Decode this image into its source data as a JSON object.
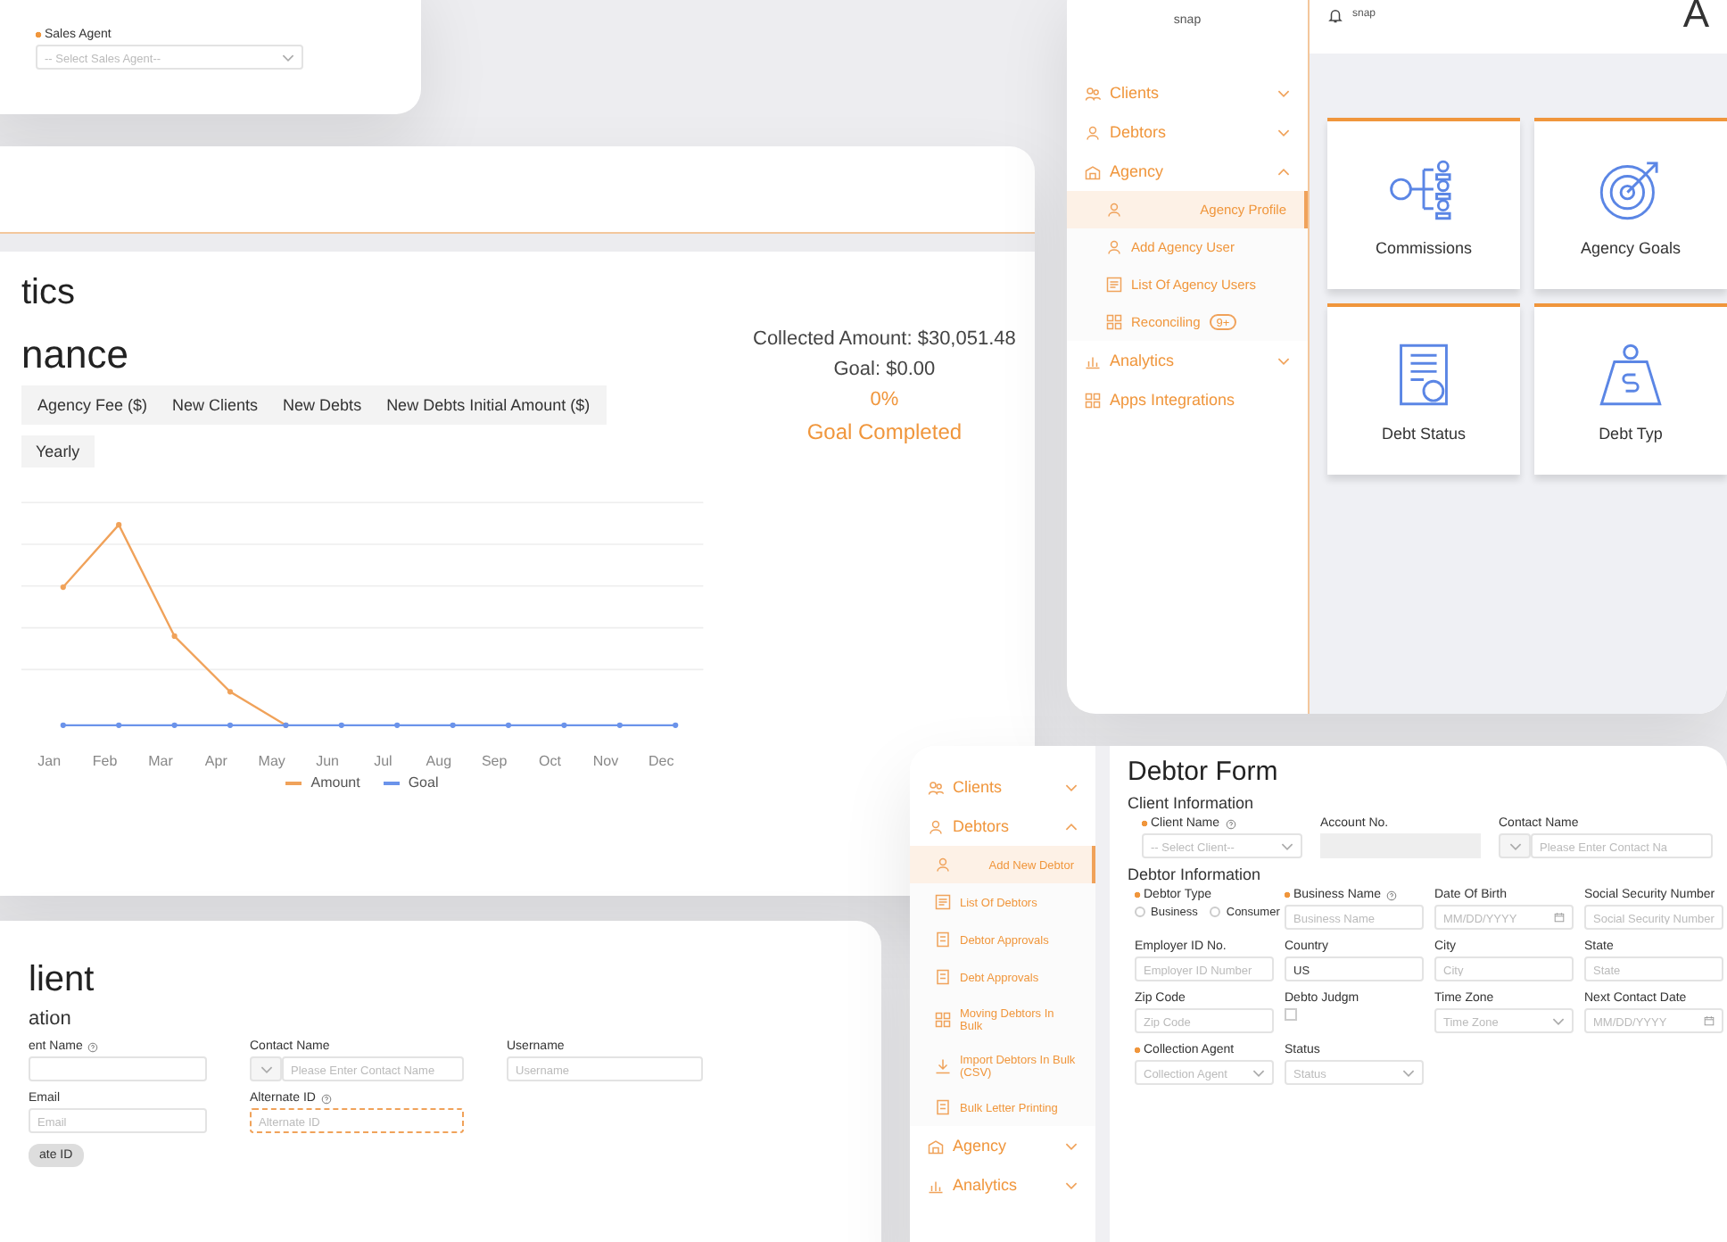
{
  "sales_agent_panel": {
    "field": {
      "label": "Sales Agent",
      "kind": "select",
      "required": true,
      "help": false,
      "placeholder": "-- Select Sales Agent--"
    }
  },
  "analytics_panel": {
    "title": "tics",
    "section_title": "nance",
    "tabs": [
      {
        "label": "Agency Fee ($)",
        "selected": false
      },
      {
        "label": "New Clients",
        "selected": false
      },
      {
        "label": "New Debts",
        "selected": false
      },
      {
        "label": "New Debts Initial Amount ($)",
        "selected": false
      }
    ],
    "period_button": "Yearly",
    "chart": {
      "months": [
        "Jan",
        "Feb",
        "Mar",
        "Apr",
        "May",
        "Jun",
        "Jul",
        "Aug",
        "Sep",
        "Oct",
        "Nov",
        "Dec"
      ],
      "legend": [
        {
          "label": "Amount",
          "color": "#f0a25a"
        },
        {
          "label": "Goal",
          "color": "#6b93ea"
        }
      ]
    },
    "stats": {
      "collected": "Collected Amount: $30,051.48",
      "goal": "Goal: $0.00",
      "percent": "0%",
      "status": "Goal Completed"
    }
  },
  "agency_app": {
    "logo": "snap",
    "user": "snap",
    "page_letter": "A",
    "sidebar": [
      {
        "label": "Clients",
        "kind": "group",
        "expanded": false
      },
      {
        "label": "Debtors",
        "kind": "group",
        "expanded": false
      },
      {
        "label": "Agency",
        "kind": "group",
        "expanded": true,
        "children": [
          {
            "label": "Agency Profile",
            "selected": true
          },
          {
            "label": "Add Agency User",
            "selected": false
          },
          {
            "label": "List Of Agency Users",
            "selected": false
          },
          {
            "label": "Reconciling",
            "selected": false,
            "badge": "9+"
          }
        ]
      },
      {
        "label": "Analytics",
        "kind": "group",
        "expanded": false
      },
      {
        "label": "Apps Integrations",
        "kind": "link"
      }
    ],
    "cards": [
      {
        "label": "Commissions"
      },
      {
        "label": "Agency Goals"
      },
      {
        "label": "Debt Status"
      },
      {
        "label": "Debt Typ"
      }
    ]
  },
  "client_form": {
    "title": "lient",
    "section": "ation",
    "fields": [
      {
        "label": "ent Name",
        "kind": "input",
        "required": false,
        "help": true,
        "focused": false
      },
      {
        "label": "Contact Name",
        "kind": "phone",
        "required": false,
        "help": false,
        "focused": false,
        "placeholder": "Please Enter Contact Name"
      },
      {
        "label": "Username",
        "kind": "input",
        "required": false,
        "help": false,
        "focused": false,
        "placeholder": "Username"
      },
      {
        "label": "Email",
        "kind": "input",
        "required": false,
        "help": false,
        "focused": false,
        "placeholder": "Email"
      },
      {
        "label": "Alternate ID",
        "kind": "input",
        "required": false,
        "help": true,
        "focused": true,
        "placeholder": "Alternate ID"
      }
    ],
    "button": "ate ID"
  },
  "debtor_form": {
    "title": "Debtor Form",
    "sidebar": [
      {
        "label": "Clients",
        "kind": "group",
        "expanded": false
      },
      {
        "label": "Debtors",
        "kind": "group",
        "expanded": true,
        "children": [
          {
            "label": "Add New Debtor",
            "selected": true
          },
          {
            "label": "List Of Debtors",
            "selected": false
          },
          {
            "label": "Debtor Approvals",
            "selected": false
          },
          {
            "label": "Debt Approvals",
            "selected": false
          },
          {
            "label": "Moving Debtors In Bulk",
            "selected": false
          },
          {
            "label": "Import Debtors In Bulk (CSV)",
            "selected": false
          },
          {
            "label": "Bulk Letter Printing",
            "selected": false
          }
        ]
      },
      {
        "label": "Agency",
        "kind": "group",
        "expanded": false
      },
      {
        "label": "Analytics",
        "kind": "group",
        "expanded": false
      }
    ],
    "client_section": "Client Information",
    "client_fields": [
      {
        "label": "Client Name",
        "kind": "select",
        "required": true,
        "help": true,
        "placeholder": "-- Select Client--"
      },
      {
        "label": "Account No.",
        "kind": "readonly",
        "required": false,
        "help": false
      },
      {
        "label": "Contact Name",
        "kind": "phone",
        "required": false,
        "help": false,
        "placeholder": "Please Enter Contact Na"
      }
    ],
    "debtor_section": "Debtor Information",
    "debtor_fields": [
      {
        "label": "Debtor Type",
        "kind": "radio",
        "required": true,
        "help": false,
        "options": [
          {
            "label": "Business",
            "selected": false
          },
          {
            "label": "Consumer",
            "selected": false
          }
        ]
      },
      {
        "label": "Business Name",
        "kind": "input",
        "required": true,
        "help": true,
        "placeholder": "Business Name"
      },
      {
        "label": "Date Of Birth",
        "kind": "date",
        "required": false,
        "help": false,
        "placeholder": "MM/DD/YYYY"
      },
      {
        "label": "Social Security Number",
        "kind": "input",
        "required": false,
        "help": false,
        "placeholder": "Social Security Number"
      },
      {
        "label": "Employer ID No.",
        "kind": "input",
        "required": false,
        "help": false,
        "placeholder": "Employer ID Number"
      },
      {
        "label": "Country",
        "kind": "input",
        "required": false,
        "help": false,
        "value": "US"
      },
      {
        "label": "City",
        "kind": "input",
        "required": false,
        "help": false,
        "placeholder": "City"
      },
      {
        "label": "State",
        "kind": "input",
        "required": false,
        "help": false,
        "placeholder": "State"
      },
      {
        "label": "Zip Code",
        "kind": "input",
        "required": false,
        "help": false,
        "placeholder": "Zip Code"
      },
      {
        "label": "Debto Judgm",
        "kind": "checkbox",
        "required": false,
        "help": false,
        "checked": false
      },
      {
        "label": "Time Zone",
        "kind": "select",
        "required": false,
        "help": false,
        "placeholder": "Time Zone"
      },
      {
        "label": "Next Contact Date",
        "kind": "date",
        "required": false,
        "help": false,
        "placeholder": "MM/DD/YYYY"
      },
      {
        "label": "Collection Agent",
        "kind": "select",
        "required": true,
        "help": false,
        "placeholder": "Collection Agent"
      },
      {
        "label": "Status",
        "kind": "select",
        "required": false,
        "help": false,
        "placeholder": "Status"
      }
    ]
  }
}
